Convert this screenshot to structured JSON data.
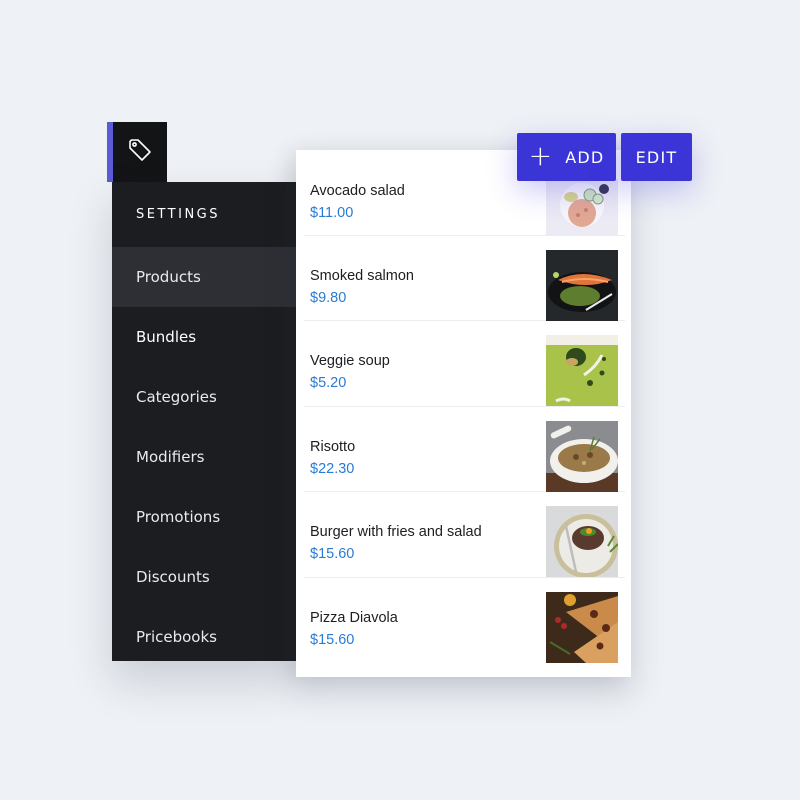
{
  "sidebar": {
    "header": "SETTINGS",
    "items": [
      {
        "label": "Products",
        "active": true
      },
      {
        "label": "Bundles"
      },
      {
        "label": "Categories"
      },
      {
        "label": "Modifiers"
      },
      {
        "label": "Promotions"
      },
      {
        "label": "Discounts"
      },
      {
        "label": "Pricebooks"
      }
    ],
    "tab_icon": "tag-icon"
  },
  "toolbar": {
    "add_icon": "plus-icon",
    "add_label": "ADD",
    "edit_label": "EDIT"
  },
  "products": [
    {
      "name": "Avocado salad",
      "price": "$11.00",
      "image": "avocado-salad-image"
    },
    {
      "name": "Smoked salmon",
      "price": "$9.80",
      "image": "smoked-salmon-image"
    },
    {
      "name": "Veggie soup",
      "price": "$5.20",
      "image": "veggie-soup-image"
    },
    {
      "name": "Risotto",
      "price": "$22.30",
      "image": "risotto-image"
    },
    {
      "name": "Burger with fries and salad",
      "price": "$15.60",
      "image": "burger-image"
    },
    {
      "name": "Pizza Diavola",
      "price": "$15.60",
      "image": "pizza-image"
    }
  ],
  "colors": {
    "accent": "#3b35d8",
    "price": "#2a7bd3",
    "sidebar_bg": "#1c1d20",
    "sidebar_active": "#2d2f34",
    "tab_stripe": "#5b5bd6"
  }
}
